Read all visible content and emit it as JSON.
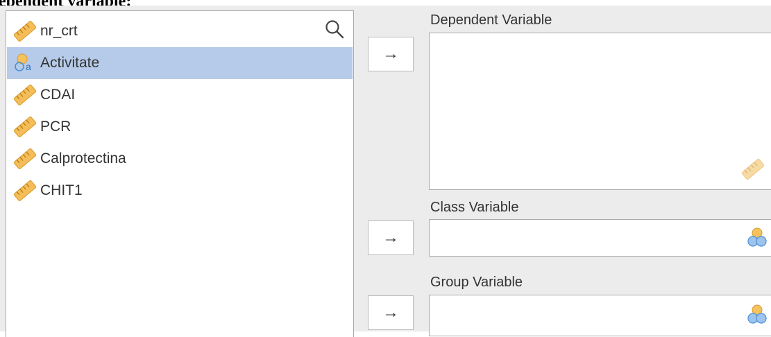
{
  "heading_fragment": "ependent variable:",
  "variables": [
    {
      "label": "nr_crt",
      "type": "continuous",
      "icon": "ruler-icon",
      "selected": false
    },
    {
      "label": "Activitate",
      "type": "nominal",
      "icon": "nominal-variable-icon",
      "selected": true
    },
    {
      "label": "CDAI",
      "type": "continuous",
      "icon": "ruler-icon",
      "selected": false
    },
    {
      "label": "PCR",
      "type": "continuous",
      "icon": "ruler-icon",
      "selected": false
    },
    {
      "label": "Calprotectina",
      "type": "continuous",
      "icon": "ruler-icon",
      "selected": false
    },
    {
      "label": "CHIT1",
      "type": "continuous",
      "icon": "ruler-icon",
      "selected": false
    }
  ],
  "move_button_label": "→",
  "targets": {
    "dependent": {
      "label": "Dependent Variable",
      "accepts_icon": "ruler-icon"
    },
    "class": {
      "label": "Class Variable",
      "accepts_icon": "nominal-icon"
    },
    "group": {
      "label": "Group Variable",
      "accepts_icon": "nominal-icon"
    }
  },
  "colors": {
    "selection": "#b6cbe9",
    "panel_background": "#ececec",
    "ruler_orange": "#f0b850",
    "nominal_blue": "#4a90d9"
  }
}
